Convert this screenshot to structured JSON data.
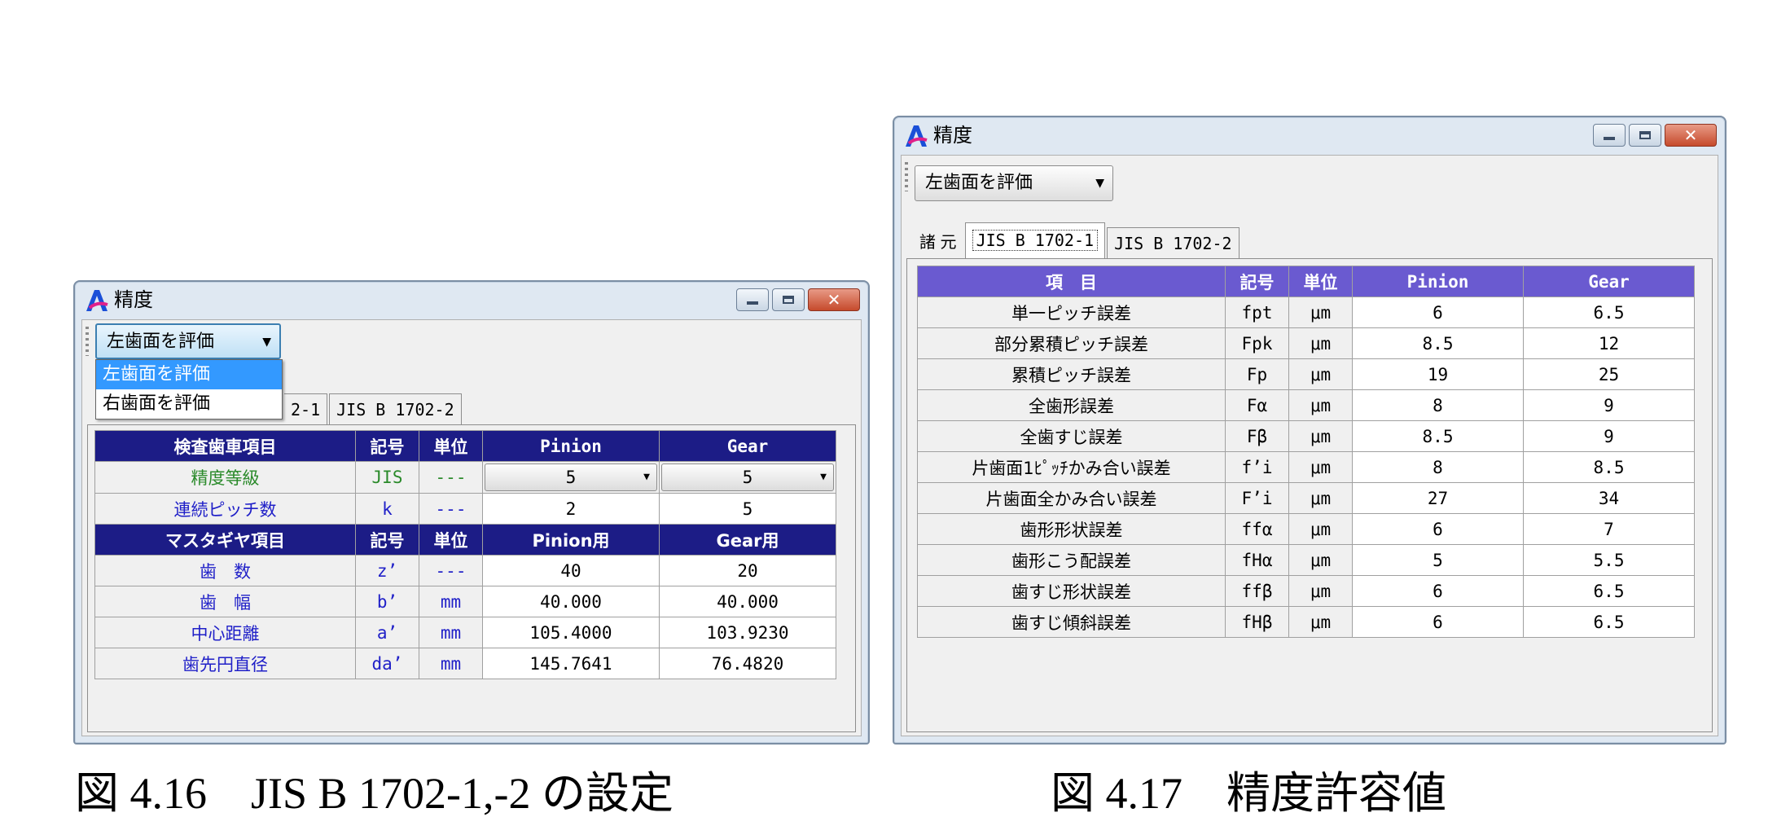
{
  "left_window": {
    "title": "精度",
    "side_combo": {
      "value": "左歯面を評価",
      "options": [
        "左歯面を評価",
        "右歯面を評価"
      ]
    },
    "tabs": [
      "2-1",
      "JIS B 1702-2"
    ],
    "inspect_header": [
      "検査歯車項目",
      "記号",
      "単位",
      "Pinion",
      "Gear"
    ],
    "inspect_rows": [
      {
        "name": "精度等級",
        "symbol": "JIS",
        "unit": "---",
        "pinion": "5",
        "gear": "5"
      },
      {
        "name": "連続ピッチ数",
        "symbol": "k",
        "unit": "---",
        "pinion": "2",
        "gear": "5"
      }
    ],
    "master_header": [
      "マスタギヤ項目",
      "記号",
      "単位",
      "Pinion用",
      "Gear用"
    ],
    "master_rows": [
      {
        "name": "歯　数",
        "symbol": "z’",
        "unit": "---",
        "pinion": "40",
        "gear": "20"
      },
      {
        "name": "歯　幅",
        "symbol": "b’",
        "unit": "mm",
        "pinion": "40.000",
        "gear": "40.000"
      },
      {
        "name": "中心距離",
        "symbol": "a’",
        "unit": "mm",
        "pinion": "105.4000",
        "gear": "103.9230"
      },
      {
        "name": "歯先円直径",
        "symbol": "da’",
        "unit": "mm",
        "pinion": "145.7641",
        "gear": "76.4820"
      }
    ]
  },
  "right_window": {
    "title": "精度",
    "side_combo": {
      "value": "左歯面を評価"
    },
    "tabs": [
      "諸 元",
      "JIS B 1702-1",
      "JIS B 1702-2"
    ],
    "header": [
      "項　目",
      "記号",
      "単位",
      "Pinion",
      "Gear"
    ],
    "rows": [
      {
        "name": "単一ピッチ誤差",
        "symbol": "fpt",
        "unit": "μm",
        "pinion": "6",
        "gear": "6.5"
      },
      {
        "name": "部分累積ピッチ誤差",
        "symbol": "Fpk",
        "unit": "μm",
        "pinion": "8.5",
        "gear": "12"
      },
      {
        "name": "累積ピッチ誤差",
        "symbol": "Fp",
        "unit": "μm",
        "pinion": "19",
        "gear": "25"
      },
      {
        "name": "全歯形誤差",
        "symbol": "Fα",
        "unit": "μm",
        "pinion": "8",
        "gear": "9"
      },
      {
        "name": "全歯すじ誤差",
        "symbol": "Fβ",
        "unit": "μm",
        "pinion": "8.5",
        "gear": "9"
      },
      {
        "name": "片歯面1ﾋﾟｯﾁかみ合い誤差",
        "symbol": "f’i",
        "unit": "μm",
        "pinion": "8",
        "gear": "8.5"
      },
      {
        "name": "片歯面全かみ合い誤差",
        "symbol": "F’i",
        "unit": "μm",
        "pinion": "27",
        "gear": "34"
      },
      {
        "name": "歯形形状誤差",
        "symbol": "ffα",
        "unit": "μm",
        "pinion": "6",
        "gear": "7"
      },
      {
        "name": "歯形こう配誤差",
        "symbol": "fHα",
        "unit": "μm",
        "pinion": "5",
        "gear": "5.5"
      },
      {
        "name": "歯すじ形状誤差",
        "symbol": "ffβ",
        "unit": "μm",
        "pinion": "6",
        "gear": "6.5"
      },
      {
        "name": "歯すじ傾斜誤差",
        "symbol": "fHβ",
        "unit": "μm",
        "pinion": "6",
        "gear": "6.5"
      }
    ]
  },
  "captions": {
    "left": "図 4.16　JIS B 1702-1,-2 の設定",
    "right": "図 4.17　精度許容値"
  },
  "colors": {
    "header_navy": "#1c1c86",
    "header_purple": "#6a5ad0",
    "highlight": "#3399ff"
  }
}
